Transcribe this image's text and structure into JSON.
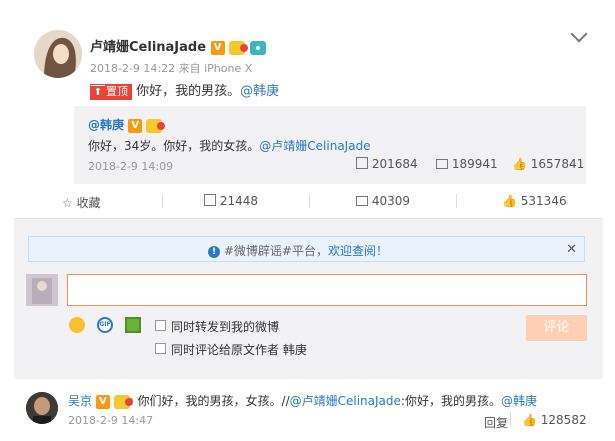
{
  "post": {
    "author": "卢靖姗CelinaJade",
    "meta": "2018-2-9 14:22 来自 iPhone X",
    "pinned_label": "置顶",
    "text_prefix": "你好，我的男孩。",
    "mention": "@韩庚"
  },
  "quote": {
    "author": "@韩庚",
    "text_prefix": "你好，34岁。你好，我的女孩。",
    "mention": "@卢靖姗CelinaJade",
    "time": "2018-2-9 14:09",
    "reposts": "201684",
    "comments": "189941",
    "likes": "1657841"
  },
  "actions": {
    "favorite": "收藏",
    "repost": "21448",
    "comment": "40309",
    "like": "531346"
  },
  "notice": {
    "text_prefix": "#微博辟谣#平台，",
    "text_link": "欢迎查阅！"
  },
  "composer": {
    "option_repost": "同时转发到我的微博",
    "option_comment_author": "同时评论给原文作者 韩庚",
    "submit": "评论"
  },
  "comment": {
    "author": "吴京",
    "text": ": 你们好，我的男孩，女孩。//",
    "mention1": "@卢靖姗CelinaJade",
    "text2": ":你好，我的男孩。",
    "mention2": "@韩庚",
    "time": "2018-2-9 14:47",
    "reply": "回复",
    "likes": "128582"
  },
  "colors": {
    "accent": "#eb7350",
    "link": "#2a79c2",
    "panel_bg": "#f2f2f5"
  }
}
